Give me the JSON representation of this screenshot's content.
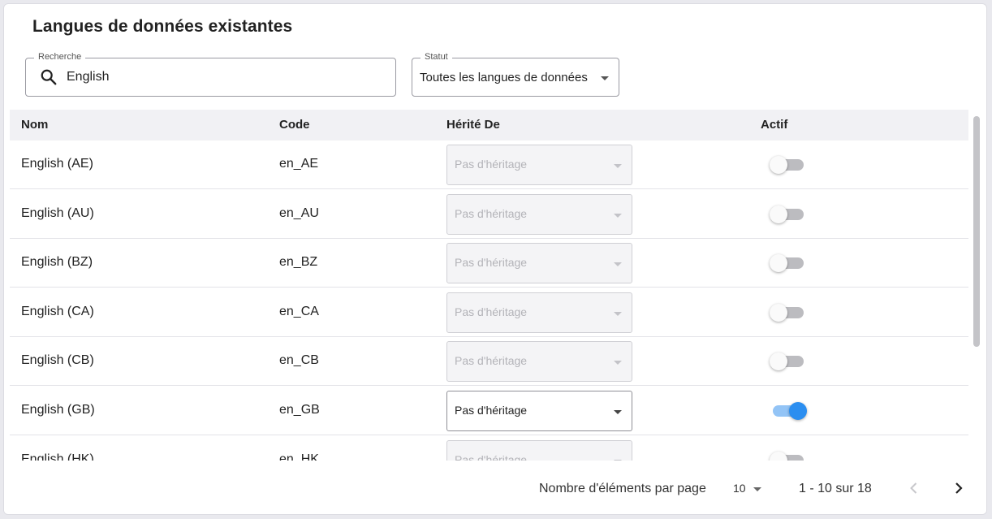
{
  "title": "Langues de données existantes",
  "search": {
    "label": "Recherche",
    "value": "English"
  },
  "status": {
    "label": "Statut",
    "value": "Toutes les langues de données"
  },
  "table": {
    "headers": {
      "name": "Nom",
      "code": "Code",
      "inherited": "Hérité De",
      "active": "Actif"
    },
    "rows": [
      {
        "name": "English (AE)",
        "code": "en_AE",
        "inherit": "Pas d'héritage",
        "inherit_enabled": false,
        "active": false
      },
      {
        "name": "English (AU)",
        "code": "en_AU",
        "inherit": "Pas d'héritage",
        "inherit_enabled": false,
        "active": false
      },
      {
        "name": "English (BZ)",
        "code": "en_BZ",
        "inherit": "Pas d'héritage",
        "inherit_enabled": false,
        "active": false
      },
      {
        "name": "English (CA)",
        "code": "en_CA",
        "inherit": "Pas d'héritage",
        "inherit_enabled": false,
        "active": false
      },
      {
        "name": "English (CB)",
        "code": "en_CB",
        "inherit": "Pas d'héritage",
        "inherit_enabled": false,
        "active": false
      },
      {
        "name": "English (GB)",
        "code": "en_GB",
        "inherit": "Pas d'héritage",
        "inherit_enabled": true,
        "active": true
      },
      {
        "name": "English (HK)",
        "code": "en_HK",
        "inherit": "Pas d'héritage",
        "inherit_enabled": false,
        "active": false
      }
    ]
  },
  "pagination": {
    "per_page_label": "Nombre d'éléments par page",
    "per_page_value": "10",
    "range": "1 - 10 sur 18"
  },
  "colors": {
    "accent": "#2b8ef0",
    "header_bg": "#f1f1f4"
  },
  "icons": {
    "search": "search-icon",
    "caret": "caret-down-icon",
    "prev": "chevron-left-icon",
    "next": "chevron-right-icon"
  }
}
